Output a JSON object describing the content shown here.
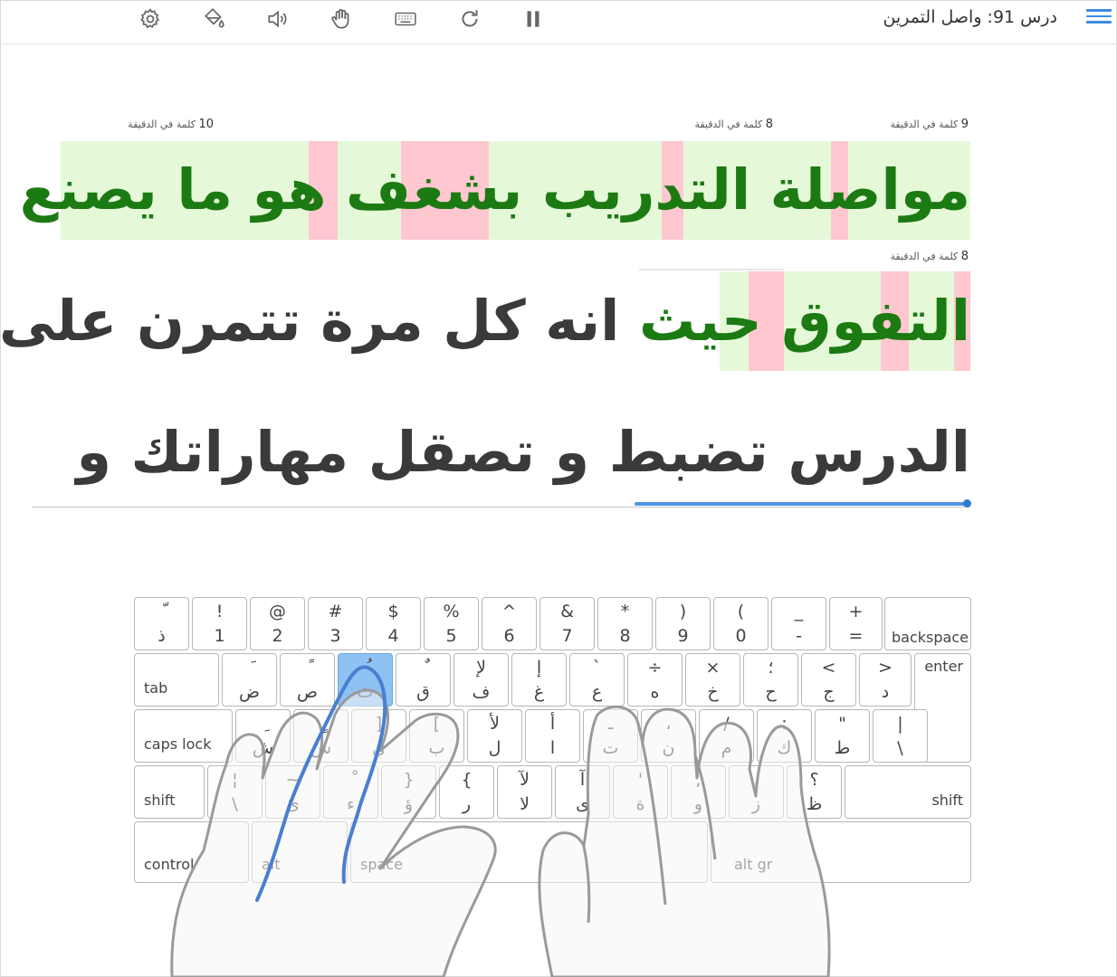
{
  "header": {
    "lesson_title": "درس 91: واصل التمرين",
    "icons": [
      "settings-icon",
      "paint-bucket-icon",
      "sound-icon",
      "hand-icon",
      "keyboard-icon",
      "restart-icon",
      "pause-icon",
      "menu-icon"
    ]
  },
  "wpm_labels": {
    "line1_right": {
      "num": "9",
      "text": "كلمة في الدقيقة"
    },
    "line1_mid": {
      "num": "8",
      "text": "كلمة في الدقيقة"
    },
    "line1_left": {
      "num": "10",
      "text": "كلمة في الدقيقة"
    },
    "line2_right": {
      "num": "8",
      "text": "كلمة في الدقيقة"
    }
  },
  "lines": {
    "line1": "مواصلة التدريب بشغف هو ما يصنع",
    "line2_typed": "التفوق حيث",
    "line2_rest": "انه كل مرة تتمرن على",
    "line3": "الدرس تضبط و تصقل مهاراتك و"
  },
  "colors": {
    "correct_bg": "#e5f9d9",
    "error_bg": "#ffc7cf",
    "correct_text": "#1c7a12",
    "error_text": "#a30d0d",
    "progress": "#5294e2",
    "active_key": "#8ec2f3"
  },
  "keyboard": {
    "row1": [
      {
        "top": "ّ",
        "bot": "ذ"
      },
      {
        "top": "!",
        "bot": "1"
      },
      {
        "top": "@",
        "bot": "2"
      },
      {
        "top": "#",
        "bot": "3"
      },
      {
        "top": "$",
        "bot": "4"
      },
      {
        "top": "%",
        "bot": "5"
      },
      {
        "top": "^",
        "bot": "6"
      },
      {
        "top": "&",
        "bot": "7"
      },
      {
        "top": "*",
        "bot": "8"
      },
      {
        "top": ")",
        "bot": "9"
      },
      {
        "top": "(",
        "bot": "0"
      },
      {
        "top": "_",
        "bot": "-"
      },
      {
        "top": "+",
        "bot": "="
      }
    ],
    "backspace": "backspace",
    "tab": "tab",
    "row2": [
      {
        "top": "َ",
        "bot": "ض"
      },
      {
        "top": "ً",
        "bot": "ص"
      },
      {
        "top": "ُ",
        "bot": "ث"
      },
      {
        "top": "ٌ",
        "bot": "ق"
      },
      {
        "top": "لإ",
        "bot": "ف"
      },
      {
        "top": "إ",
        "bot": "غ"
      },
      {
        "top": "`",
        "bot": "ع"
      },
      {
        "top": "÷",
        "bot": "ه"
      },
      {
        "top": "×",
        "bot": "خ"
      },
      {
        "top": "؛",
        "bot": "ح"
      },
      {
        "top": "<",
        "bot": "ج"
      },
      {
        "top": ">",
        "bot": "د"
      }
    ],
    "enter": "enter",
    "caps_lock": "caps lock",
    "row3": [
      {
        "top": "ِ",
        "bot": "ش"
      },
      {
        "top": "ٍ",
        "bot": "س"
      },
      {
        "top": "]",
        "bot": "ي"
      },
      {
        "top": "[",
        "bot": "ب"
      },
      {
        "top": "لأ",
        "bot": "ل"
      },
      {
        "top": "أ",
        "bot": "ا"
      },
      {
        "top": "ـ",
        "bot": "ت"
      },
      {
        "top": "،",
        "bot": "ن"
      },
      {
        "top": "/",
        "bot": "م"
      },
      {
        "top": ":",
        "bot": "ك"
      },
      {
        "top": "\"",
        "bot": "ط"
      },
      {
        "top": "|",
        "bot": "\\"
      }
    ],
    "shift_left": "shift",
    "row4": [
      {
        "top": "¦",
        "bot": "\\"
      },
      {
        "top": "~",
        "bot": "ئ"
      },
      {
        "top": "ْ",
        "bot": "ء"
      },
      {
        "top": "}",
        "bot": "ؤ"
      },
      {
        "top": "{",
        "bot": "ر"
      },
      {
        "top": "لآ",
        "bot": "لا"
      },
      {
        "top": "آ",
        "bot": "ى"
      },
      {
        "top": "'",
        "bot": "ة"
      },
      {
        "top": ",",
        "bot": "و"
      },
      {
        "top": ".",
        "bot": "ز"
      },
      {
        "top": "؟",
        "bot": "ظ"
      }
    ],
    "shift_right": "shift",
    "control": "control",
    "alt": "alt",
    "space": "space",
    "alt_gr": "alt gr"
  }
}
